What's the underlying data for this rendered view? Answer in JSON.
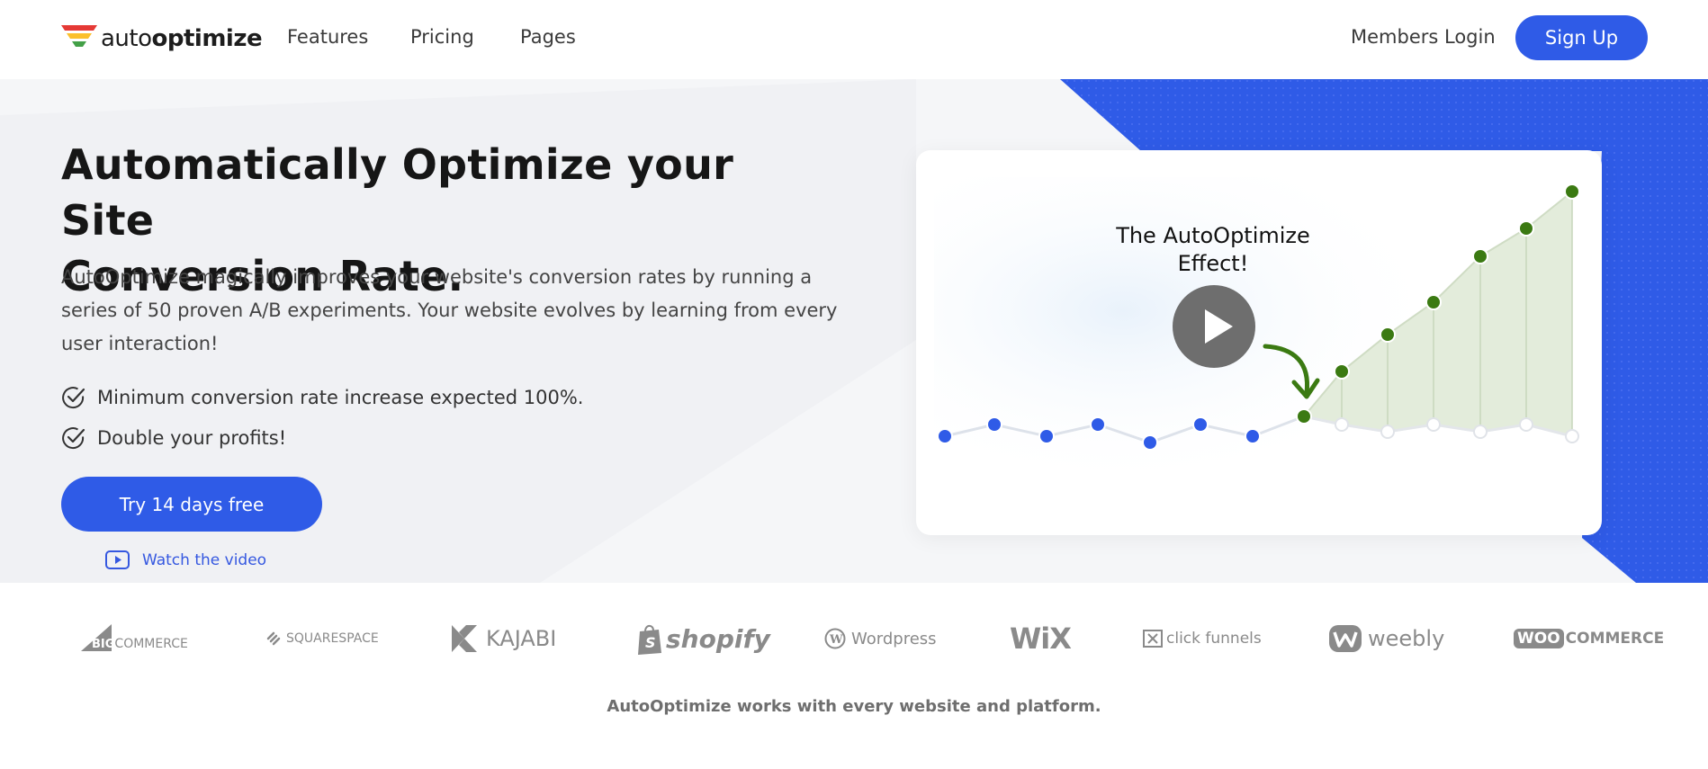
{
  "nav": {
    "logo_regular": "auto",
    "logo_bold": "optimize",
    "links": [
      "Features",
      "Pricing",
      "Pages"
    ],
    "members_login": "Members Login",
    "sign_up": "Sign Up"
  },
  "hero": {
    "headline_line1": "Automatically Optimize your Site",
    "headline_line2": "Conversion Rate.",
    "subtext": "AutoOptimize magically improves your website's conversion rates by running a series of 50 proven A/B experiments. Your website evolves by learning from every user interaction!",
    "bullets": [
      "Minimum conversion rate increase expected 100%.",
      "Double your profits!"
    ],
    "cta_label": "Try 14 days free",
    "watch_label": "Watch the video"
  },
  "video": {
    "title_line1": "The AutoOptimize",
    "title_line2": "Effect!"
  },
  "brands": {
    "big_prefix": "BIG",
    "bigcommerce": "COMMERCE",
    "squarespace": "SQUARESPACE",
    "kajabi": "KAJABI",
    "shopify": "shopify",
    "wordpress": "Wordpress",
    "wix": "WiX",
    "clickfunnels": "click funnels",
    "weebly": "weebly",
    "woo_prefix": "WOO",
    "woocommerce": "COMMERCE"
  },
  "tagline": "AutoOptimize works with every website and platform.",
  "colors": {
    "accent": "#2f5be7",
    "green_dot": "#3b7a12",
    "blue_dot": "#2f5be7"
  }
}
